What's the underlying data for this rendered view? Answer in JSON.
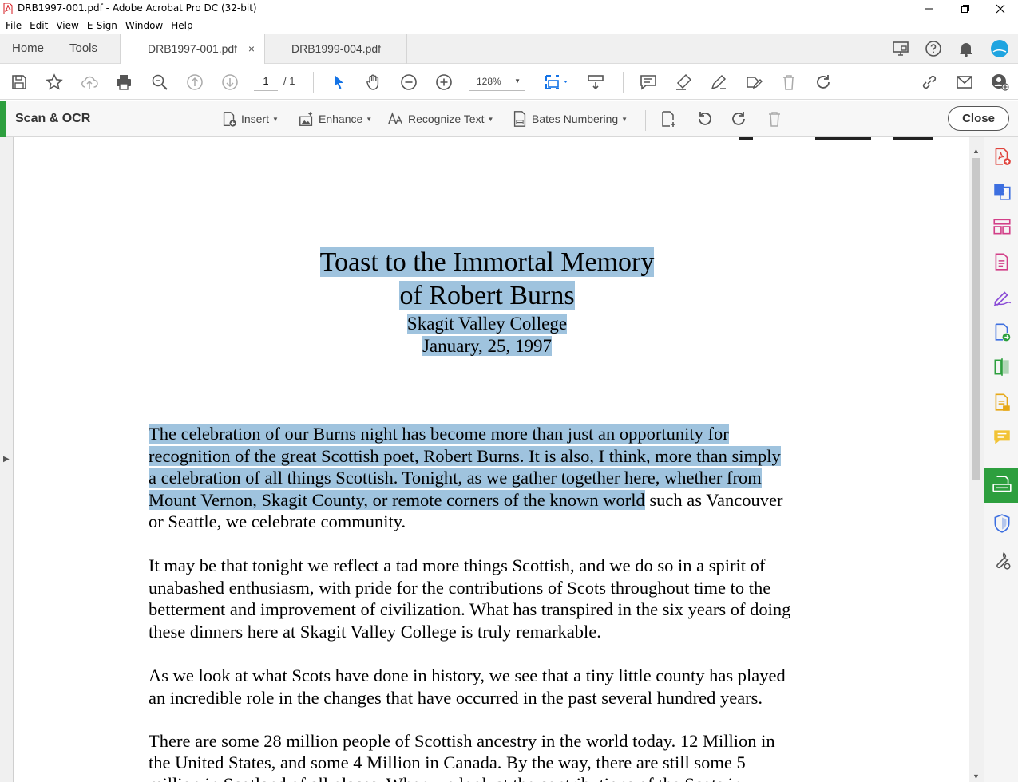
{
  "window": {
    "title": "DRB1997-001.pdf - Adobe Acrobat Pro DC (32-bit)"
  },
  "menu": [
    "File",
    "Edit",
    "View",
    "E-Sign",
    "Window",
    "Help"
  ],
  "tabs": {
    "home": "Home",
    "tools": "Tools",
    "documents": [
      {
        "label": "DRB1997-001.pdf",
        "active": true,
        "close": "×"
      },
      {
        "label": "DRB1999-004.pdf",
        "active": false
      }
    ]
  },
  "toolbar": {
    "current_page": "1",
    "page_total": "/ 1",
    "zoom": "128%"
  },
  "ocr": {
    "title": "Scan & OCR",
    "insert": "Insert",
    "enhance": "Enhance",
    "recognize_text": "Recognize Text",
    "bates_numbering": "Bates Numbering",
    "close": "Close"
  },
  "document": {
    "title_line1": "Toast to the Immortal Memory",
    "title_line2": "of Robert Burns",
    "subtitle": "Skagit Valley College",
    "date": "January, 25, 1997",
    "paragraphs": [
      {
        "lines": [
          {
            "highlighted": "The celebration of our Burns night has become more than just an opportunity for",
            "rest": ""
          },
          {
            "highlighted": "recognition of the great Scottish poet, Robert Burns.  It is also, I think, more than simply",
            "rest": ""
          },
          {
            "highlighted": "a celebration of all things Scottish.  Tonight, as we gather together here,  whether from",
            "rest": ""
          },
          {
            "highlighted": "Mount Vernon, Skagit County, or remote corners of the known world",
            "rest": " such as Vancouver"
          },
          {
            "highlighted": "",
            "rest": "or Seattle, we celebrate community."
          }
        ]
      },
      {
        "lines": [
          {
            "highlighted": "",
            "rest": "It may be that tonight we reflect a tad more things Scottish, and we do so in a spirit of"
          },
          {
            "highlighted": "",
            "rest": "unabashed enthusiasm, with pride for the contributions of Scots throughout time to the"
          },
          {
            "highlighted": "",
            "rest": "betterment and improvement of civilization.  What has transpired in the six years of doing"
          },
          {
            "highlighted": "",
            "rest": "these dinners here at Skagit Valley College is truly remarkable."
          }
        ]
      },
      {
        "lines": [
          {
            "highlighted": "",
            "rest": "As we look at what Scots have done in history, we see that a tiny little county has played"
          },
          {
            "highlighted": "",
            "rest": "an incredible role in the changes that have occurred in the past several hundred years."
          }
        ]
      },
      {
        "lines": [
          {
            "highlighted": "",
            "rest": "There are some 28 million people of Scottish ancestry in the world today.  12 Million in"
          },
          {
            "highlighted": "",
            "rest": "the United States, and some 4 Million in Canada.  By the way, there are still some 5"
          },
          {
            "highlighted": "",
            "rest": "million in Scotland of all places.  When we look at the contributions of the Scots in"
          }
        ]
      }
    ]
  },
  "colors": {
    "highlight": "#9fc3de",
    "tool_accent": "#2d9f3e"
  }
}
